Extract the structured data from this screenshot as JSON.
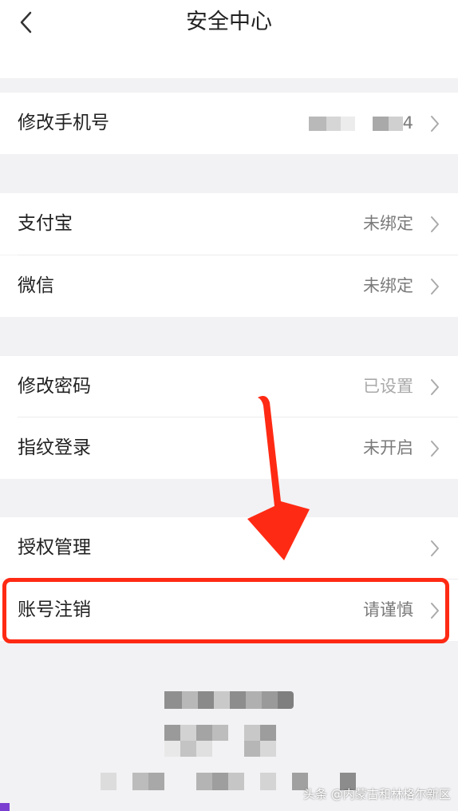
{
  "header": {
    "title": "安全中心"
  },
  "groups": [
    {
      "rows": [
        {
          "label": "修改手机号",
          "value": "4"
        }
      ]
    },
    {
      "rows": [
        {
          "label": "支付宝",
          "value": "未绑定"
        },
        {
          "label": "微信",
          "value": "未绑定"
        }
      ]
    },
    {
      "rows": [
        {
          "label": "修改密码",
          "value": "已设置"
        },
        {
          "label": "指纹登录",
          "value": "未开启"
        }
      ]
    },
    {
      "rows": [
        {
          "label": "授权管理",
          "value": ""
        },
        {
          "label": "账号注销",
          "value": "请谨慎"
        }
      ]
    }
  ],
  "watermark": "头条 @内蒙古和林格尔新区",
  "colors": {
    "highlight": "#ff2a14",
    "background": "#f2f2f4",
    "value_text": "#7a7a7a"
  },
  "icons": [
    "back-icon",
    "chevron-right-icon",
    "arrow-down-annotation-icon"
  ]
}
